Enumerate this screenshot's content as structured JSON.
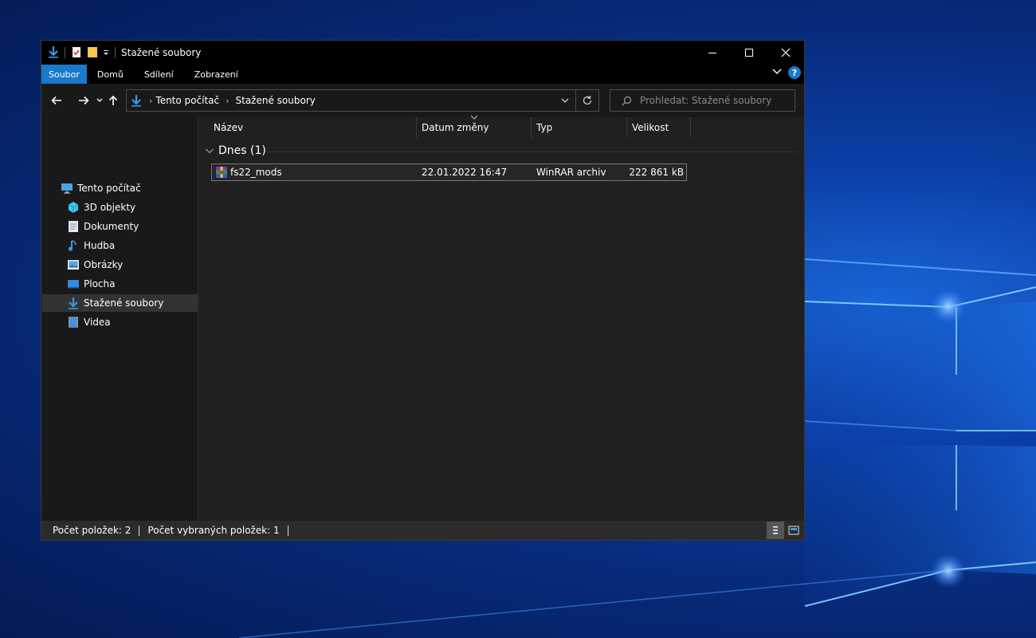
{
  "window": {
    "title": "Stažené soubory",
    "controls": {
      "minimize": "—",
      "maximize": "☐",
      "close": "✕"
    }
  },
  "ribbon": {
    "tabs": [
      {
        "label": "Soubor",
        "active": true
      },
      {
        "label": "Domů"
      },
      {
        "label": "Sdílení"
      },
      {
        "label": "Zobrazení"
      }
    ],
    "help": "?"
  },
  "address": {
    "breadcrumbs": [
      "Tento počítač",
      "Stažené soubory"
    ],
    "separator": "›"
  },
  "search": {
    "placeholder": "Prohledat: Stažené soubory"
  },
  "sidebar": {
    "items": [
      {
        "label": "Tento počítač",
        "icon": "pc-icon",
        "level": 0
      },
      {
        "label": "3D objekty",
        "icon": "3d-objects-icon",
        "level": 1
      },
      {
        "label": "Dokumenty",
        "icon": "documents-icon",
        "level": 1
      },
      {
        "label": "Hudba",
        "icon": "music-icon",
        "level": 1
      },
      {
        "label": "Obrázky",
        "icon": "pictures-icon",
        "level": 1
      },
      {
        "label": "Plocha",
        "icon": "desktop-icon",
        "level": 1
      },
      {
        "label": "Stažené soubory",
        "icon": "downloads-icon",
        "level": 1,
        "selected": true
      },
      {
        "label": "Videa",
        "icon": "videos-icon",
        "level": 1
      }
    ]
  },
  "columns": [
    "Název",
    "Datum změny",
    "Typ",
    "Velikost"
  ],
  "groups": [
    {
      "label": "Dnes (1)",
      "files": [
        {
          "name": "fs22_mods",
          "date": "22.01.2022 16:47",
          "type": "WinRAR archiv",
          "size": "222 861 kB",
          "icon": "winrar-archive-icon"
        }
      ]
    }
  ],
  "status": {
    "items_count": "Počet položek: 2",
    "selected_count": "Počet vybraných položek: 1"
  },
  "colors": {
    "accent": "#1979ca",
    "window_bg": "#191919",
    "pane_bg": "#202020",
    "titlebar_bg": "#000000"
  }
}
